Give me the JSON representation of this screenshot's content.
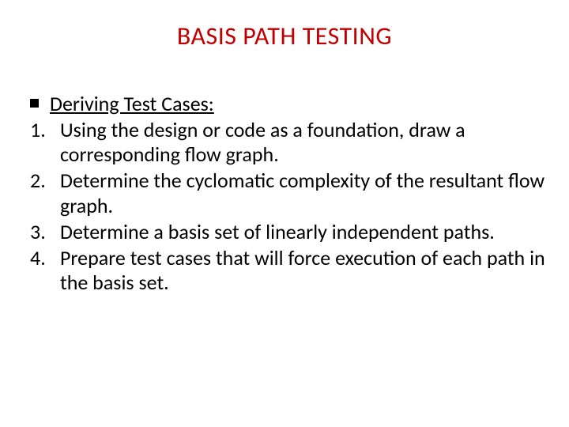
{
  "slide": {
    "title": "BASIS PATH TESTING",
    "subheading": "Deriving Test Cases:",
    "items": [
      "Using the design or code as a foundation, draw a corresponding flow graph.",
      "Determine the cyclomatic complexity of the resultant flow graph.",
      "Determine a basis set of linearly independent paths.",
      "Prepare test cases that will force execution of each path in the basis set."
    ]
  }
}
